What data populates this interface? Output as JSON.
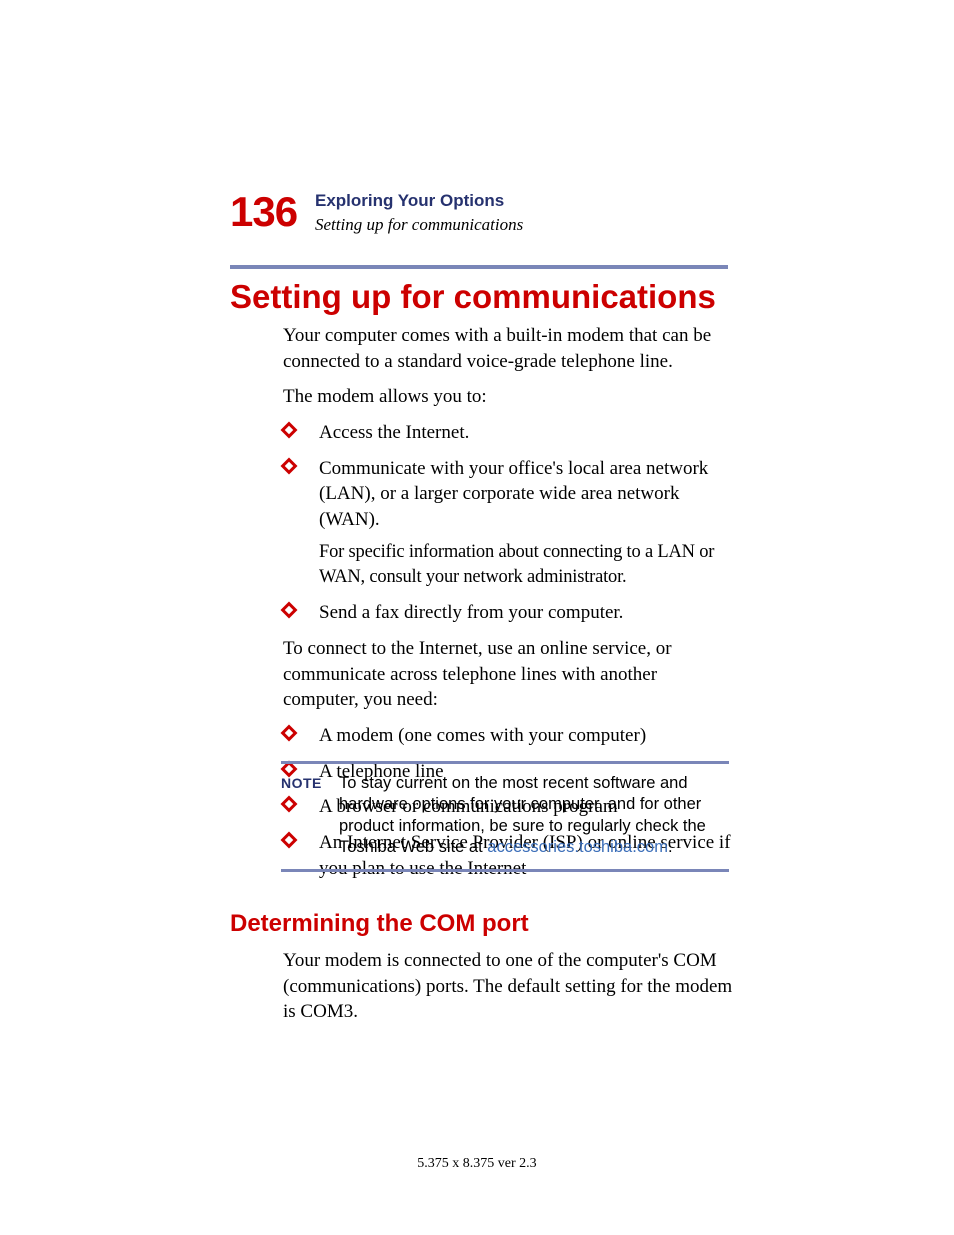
{
  "header": {
    "page_number": "136",
    "chapter": "Exploring Your Options",
    "section": "Setting up for communications"
  },
  "h1": "Setting up for communications",
  "intro_p1": "Your computer comes with a built-in modem that can be connected to a standard voice-grade telephone line.",
  "intro_p2": "The modem allows you to:",
  "list1": {
    "i0": "Access the Internet.",
    "i1": "Communicate with your office's local area network (LAN), or a larger corporate wide area network (WAN).",
    "i1_sub": "For specific information about connecting to a LAN or WAN, consult your network administrator.",
    "i2": "Send a fax directly from your computer."
  },
  "mid_p": "To connect to the Internet, use an online service, or communicate across telephone lines with another computer, you need:",
  "list2": {
    "i0": "A modem (one comes with your computer)",
    "i1": "A telephone line",
    "i2": "A browser or communications program",
    "i3": "An Internet Service Provider (ISP) or online service if you plan to use the Internet"
  },
  "note": {
    "label": "NOTE",
    "text_before": "To stay current on the most recent software and hardware options for your computer, and for other product information, be sure to regularly check the Toshiba Web site at ",
    "link": "accessories.toshiba.com",
    "text_after": "."
  },
  "h2": "Determining the COM port",
  "h2_p": "Your modem is connected to one of the computer's COM (communications) ports. The default setting for the modem is COM3.",
  "footer": "5.375 x 8.375 ver 2.3"
}
